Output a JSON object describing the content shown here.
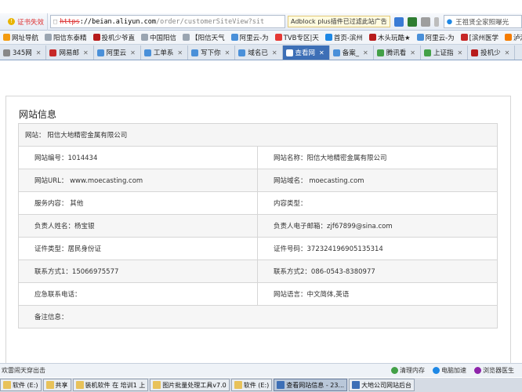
{
  "address_bar": {
    "cert_error": "证书失效",
    "url_https": "https",
    "url_host": "://beian.aliyun.com",
    "url_rest": "/order/customerSiteView?sit",
    "adblock": "Adblock plus插件已过滤此站广告",
    "search_text": "王祖贤全家照曝光"
  },
  "bookmarks": [
    {
      "label": "网址导航",
      "color": "#f39c12"
    },
    {
      "label": "阳信东泰精",
      "color": "#9aa5b1"
    },
    {
      "label": "投机少爷直",
      "color": "#b71c1c"
    },
    {
      "label": "中国阳信",
      "color": "#9aa5b1"
    },
    {
      "label": "【阳信天气",
      "color": "#9aa5b1"
    },
    {
      "label": "阿里云-为",
      "color": "#4a90d9"
    },
    {
      "label": "TVB专区|天",
      "color": "#e53935"
    },
    {
      "label": "首页-滨州",
      "color": "#1e88e5"
    },
    {
      "label": "木头玩酷★",
      "color": "#b71c1c"
    },
    {
      "label": "阿里云-为",
      "color": "#4a90d9"
    },
    {
      "label": "[滨州医学",
      "color": "#c62828"
    },
    {
      "label": "泸湘通行",
      "color": "#f57c00"
    }
  ],
  "tabs": [
    {
      "label": "345网",
      "active": false,
      "color": "#888"
    },
    {
      "label": "网易邮",
      "active": false,
      "color": "#c62828"
    },
    {
      "label": "阿里云",
      "active": false,
      "color": "#4a90d9"
    },
    {
      "label": "工单系",
      "active": false,
      "color": "#4a90d9"
    },
    {
      "label": "写下你",
      "active": false,
      "color": "#4a90d9"
    },
    {
      "label": "域名已",
      "active": false,
      "color": "#4a90d9"
    },
    {
      "label": "查看网",
      "active": true,
      "color": "#ffffff"
    },
    {
      "label": "备案_",
      "active": false,
      "color": "#4a90d9"
    },
    {
      "label": "腾讯看",
      "active": false,
      "color": "#43a047"
    },
    {
      "label": "上证指",
      "active": false,
      "color": "#43a047"
    },
    {
      "label": "投机少",
      "active": false,
      "color": "#b71c1c"
    }
  ],
  "panel": {
    "title": "网站信息",
    "site_row": "网站： 阳信大地精密金属有限公司",
    "rows": [
      [
        "网站编号：1014434",
        "网站名称：阳信大地精密金属有限公司"
      ],
      [
        "网站URL： www.moecasting.com",
        "网站域名： moecasting.com"
      ],
      [
        "服务内容： 其他",
        "内容类型："
      ],
      [
        "负责人姓名：杨宝银",
        "负责人电子邮箱：zjf67899@sina.com"
      ],
      [
        "证件类型：居民身份证",
        "证件号码：372324196905135314"
      ],
      [
        "联系方式1：15066975577",
        "联系方式2：086-0543-8380977"
      ],
      [
        "应急联系电话：",
        "网站语言：中文简体,英语"
      ],
      [
        "备注信息：",
        ""
      ]
    ]
  },
  "status_bar": {
    "left": "欢雷闹天穿出击",
    "items": [
      "清理内存",
      "电脑加速",
      "浏览器医生"
    ]
  },
  "taskbar": [
    {
      "label": "软件 (E:)",
      "active": false,
      "color": "#e8c25a"
    },
    {
      "label": "共享",
      "active": false,
      "color": "#e8c25a"
    },
    {
      "label": "装机软件 在 培训1 上",
      "active": false,
      "color": "#e8c25a"
    },
    {
      "label": "图片批量处理工具v7.0",
      "active": false,
      "color": "#e8c25a"
    },
    {
      "label": "软件 (E:)",
      "active": false,
      "color": "#e8c25a"
    },
    {
      "label": "查看网站信息 - 23...",
      "active": true,
      "color": "#3d6fb6"
    },
    {
      "label": "大地公司网站后台",
      "active": false,
      "color": "#3d6fb6"
    }
  ]
}
